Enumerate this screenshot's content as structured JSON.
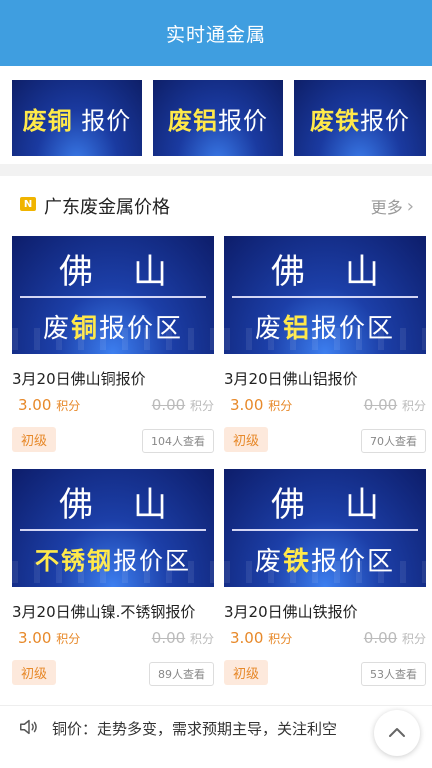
{
  "header": {
    "title": "实时通金属"
  },
  "banners": [
    {
      "highlight": "废铜",
      "rest": " 报价"
    },
    {
      "highlight": "废铝",
      "rest": "报价"
    },
    {
      "highlight": "废铁",
      "rest": "报价"
    }
  ],
  "section": {
    "icon_text": "N",
    "title": "广东废金属价格",
    "more": "更多"
  },
  "cards": [
    {
      "thumb_top": "佛山",
      "thumb_pre": "废",
      "thumb_hl": "铜",
      "thumb_post": "报价区",
      "title": "3月20日佛山铜报价",
      "price": "3.00",
      "price_unit": "积分",
      "old_price": "0.00",
      "old_unit": "积分",
      "level": "初级",
      "views": "104人查看"
    },
    {
      "thumb_top": "佛山",
      "thumb_pre": "废",
      "thumb_hl": "铝",
      "thumb_post": "报价区",
      "title": "3月20日佛山铝报价",
      "price": "3.00",
      "price_unit": "积分",
      "old_price": "0.00",
      "old_unit": "积分",
      "level": "初级",
      "views": "70人查看"
    },
    {
      "thumb_top": "佛山",
      "thumb_pre": "",
      "thumb_hl": "不锈钢",
      "thumb_post": "报价区",
      "title": "3月20日佛山镍.不锈钢报价",
      "price": "3.00",
      "price_unit": "积分",
      "old_price": "0.00",
      "old_unit": "积分",
      "level": "初级",
      "views": "89人查看"
    },
    {
      "thumb_top": "佛山",
      "thumb_pre": "废",
      "thumb_hl": "铁",
      "thumb_post": "报价区",
      "title": "3月20日佛山铁报价",
      "price": "3.00",
      "price_unit": "积分",
      "old_price": "0.00",
      "old_unit": "积分",
      "level": "初级",
      "views": "53人查看"
    }
  ],
  "ticker": {
    "text": "铜价：走势多变，需求预期主导，关注利空"
  },
  "icons": {
    "speaker": "speaker-icon",
    "back_to_top": "chevron-up-icon",
    "more": "chevron-right-icon"
  }
}
